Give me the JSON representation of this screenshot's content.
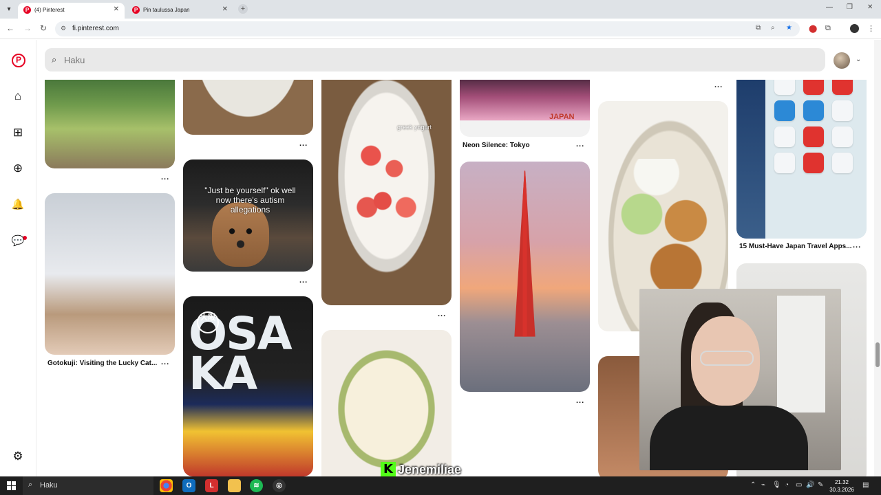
{
  "browser": {
    "tabs": [
      {
        "title": "(4) Pinterest",
        "active": true
      },
      {
        "title": "Pin taulussa Japan",
        "active": false
      }
    ],
    "new_tab": "+",
    "url": "fi.pinterest.com",
    "window_controls": {
      "minimize": "—",
      "restore": "❐",
      "close": "✕"
    }
  },
  "sidebar": {
    "logo": "P",
    "items": [
      {
        "name": "home",
        "icon": "⌂"
      },
      {
        "name": "explore",
        "icon": "⊞"
      },
      {
        "name": "create",
        "icon": "⊕"
      },
      {
        "name": "notifications",
        "icon": "🔔"
      },
      {
        "name": "messages",
        "icon": "💬"
      },
      {
        "name": "settings",
        "icon": "⚙"
      }
    ],
    "notification_dot_color": "#e60023"
  },
  "search": {
    "placeholder": "Haku",
    "icon": "search-icon"
  },
  "header": {
    "avatar_chevron": "⌄"
  },
  "pins": {
    "more_label": "...",
    "tokyo_title": "Neon Silence: Tokyo",
    "gotokuji_title": "Gotokuji: Visiting the Lucky Cat...",
    "japan_apps_title": "15 Must-Have Japan Travel Apps...",
    "dog_meme_text": "\"Just be yourself\" ok well now there's autism allegations",
    "grapefruit_overlay": "greek yogurt",
    "japan_poster_text": "JAPAN",
    "osaka_text": "OSA KA",
    "osaka_kanji": "大阪"
  },
  "stream_overlay": {
    "platform_letter": "K",
    "streamer_name": "Jenemiliae",
    "accent": "#53fc18"
  },
  "taskbar": {
    "search_label": "Haku",
    "time": "21.32",
    "date": "30.3.2026"
  },
  "colors": {
    "brand": "#e60023",
    "search_bg": "#e9e9e9"
  }
}
